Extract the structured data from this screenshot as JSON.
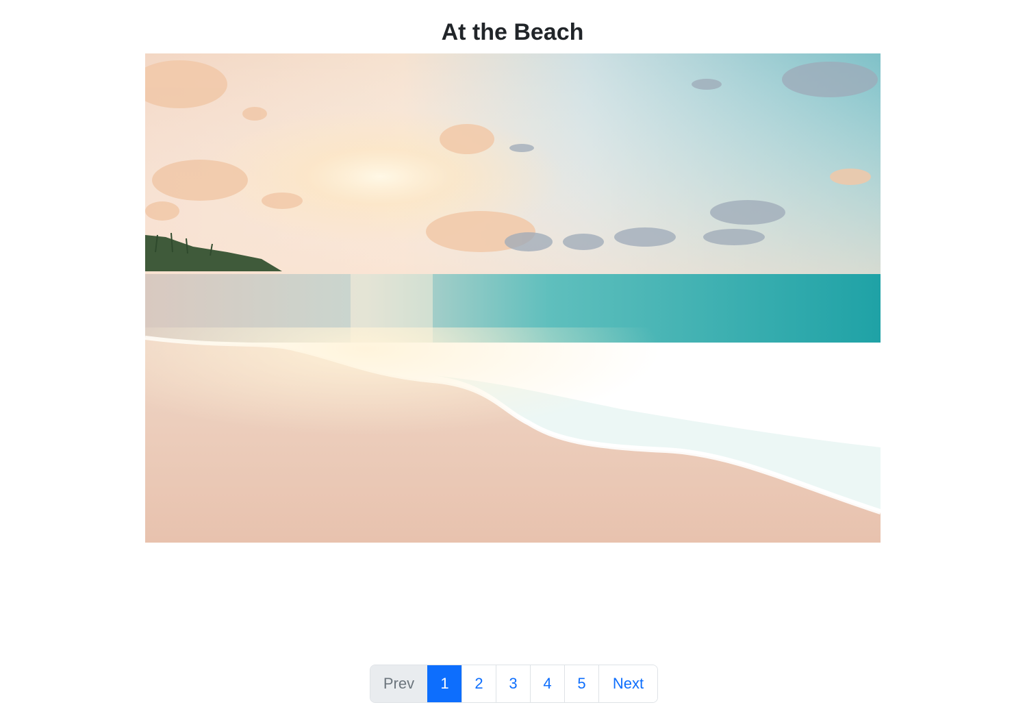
{
  "page": {
    "title": "At the Beach"
  },
  "photo": {
    "subject": "beach-sunset-photo"
  },
  "pagination": {
    "prev_label": "Prev",
    "next_label": "Next",
    "pages": [
      "1",
      "2",
      "3",
      "4",
      "5"
    ],
    "current_page": "1",
    "prev_disabled": true
  },
  "colors": {
    "accent": "#0d6efd",
    "title_text": "#212529",
    "disabled_bg": "#e9ecef",
    "disabled_text": "#6c757d",
    "border": "#dee2e6"
  }
}
